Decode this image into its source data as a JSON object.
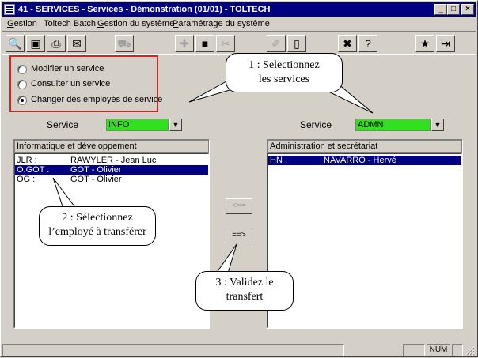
{
  "window": {
    "title": "41 - SERVICES - Services - Démonstration (01/01) - TOLTECH",
    "btn_minimize": "_",
    "btn_maximize": "□",
    "btn_close": "×"
  },
  "menu": [
    {
      "label": "Gestion",
      "u": "G",
      "rest": "estion"
    },
    {
      "label": "Toltech Batch",
      "u": "",
      "rest": "Toltech Batch"
    },
    {
      "label": "Gestion du système",
      "u": "G",
      "rest": "estion du système"
    },
    {
      "label": "Paramétrage du système",
      "u": "P",
      "rest": "aramétrage du système"
    }
  ],
  "toolbar": {
    "icons": [
      "search-icon",
      "camera-icon",
      "printer-icon",
      "envelope-icon",
      "truck-icon",
      "add-icon",
      "save-icon",
      "cut-icon",
      "edit-icon",
      "new-page-icon",
      "excel-icon",
      "help-pointer-icon",
      "magic-wand-icon",
      "exit-door-icon"
    ]
  },
  "radio_group": {
    "options": [
      {
        "label": "Modifier un service",
        "checked": false
      },
      {
        "label": "Consulter un service",
        "checked": false
      },
      {
        "label": "Changer des employés de service",
        "checked": true
      }
    ]
  },
  "callouts": {
    "c1_line1": "1 : Selectionnez",
    "c1_line2": "les services",
    "c2_line1": "2 : Sélectionnez",
    "c2_line2": "l’employé à transférer",
    "c3_line1": "3 : Validez le",
    "c3_line2": "transfert"
  },
  "left": {
    "service_label": "Service",
    "service_value": "INFO",
    "list_header": "Informatique et développement",
    "rows": [
      {
        "code": "JLR :",
        "name": "RAWYLER - Jean Luc",
        "selected": false
      },
      {
        "code": "O.GOT :",
        "name": "GOT - Olivier",
        "selected": true
      },
      {
        "code": "OG :",
        "name": "GOT - Olivier",
        "selected": false
      }
    ]
  },
  "right": {
    "service_label": "Service",
    "service_value": "ADMN",
    "list_header": "Administration et secrétariat",
    "rows": [
      {
        "code": "HN :",
        "name": "NAVARRO - Hervé",
        "selected": true
      }
    ]
  },
  "buttons": {
    "move_left": "<==",
    "move_right": "==>"
  },
  "status": {
    "num": "NUM"
  },
  "colors": {
    "selection": "#000080",
    "combo_bg": "#33e020",
    "highlight_border": "#e02020"
  }
}
